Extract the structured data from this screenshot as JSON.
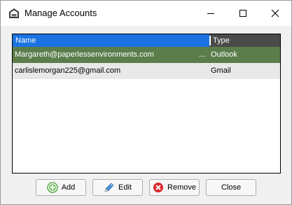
{
  "window": {
    "title": "Manage Accounts"
  },
  "list": {
    "columns": [
      "Name",
      "Type"
    ],
    "rows": [
      {
        "name": "Margareth@paperlessenvironments.com",
        "ellipsis": "...",
        "type": "Outlook",
        "selected": true
      },
      {
        "name": "carlislemorgan225@gmail.com",
        "ellipsis": "",
        "type": "Gmail",
        "selected": false
      }
    ]
  },
  "buttons": {
    "add": "Add",
    "edit": "Edit",
    "remove": "Remove",
    "close": "Close"
  },
  "icons": {
    "app": "mail-tray-icon",
    "add": "add-circle-icon",
    "edit": "pencil-icon",
    "remove": "remove-circle-icon"
  },
  "colors": {
    "header_name_bg": "#1a73e0",
    "header_bg": "#4a4a4a",
    "selected_row_bg": "#5b7d4b",
    "alt_row_bg": "#e8e8e8"
  }
}
